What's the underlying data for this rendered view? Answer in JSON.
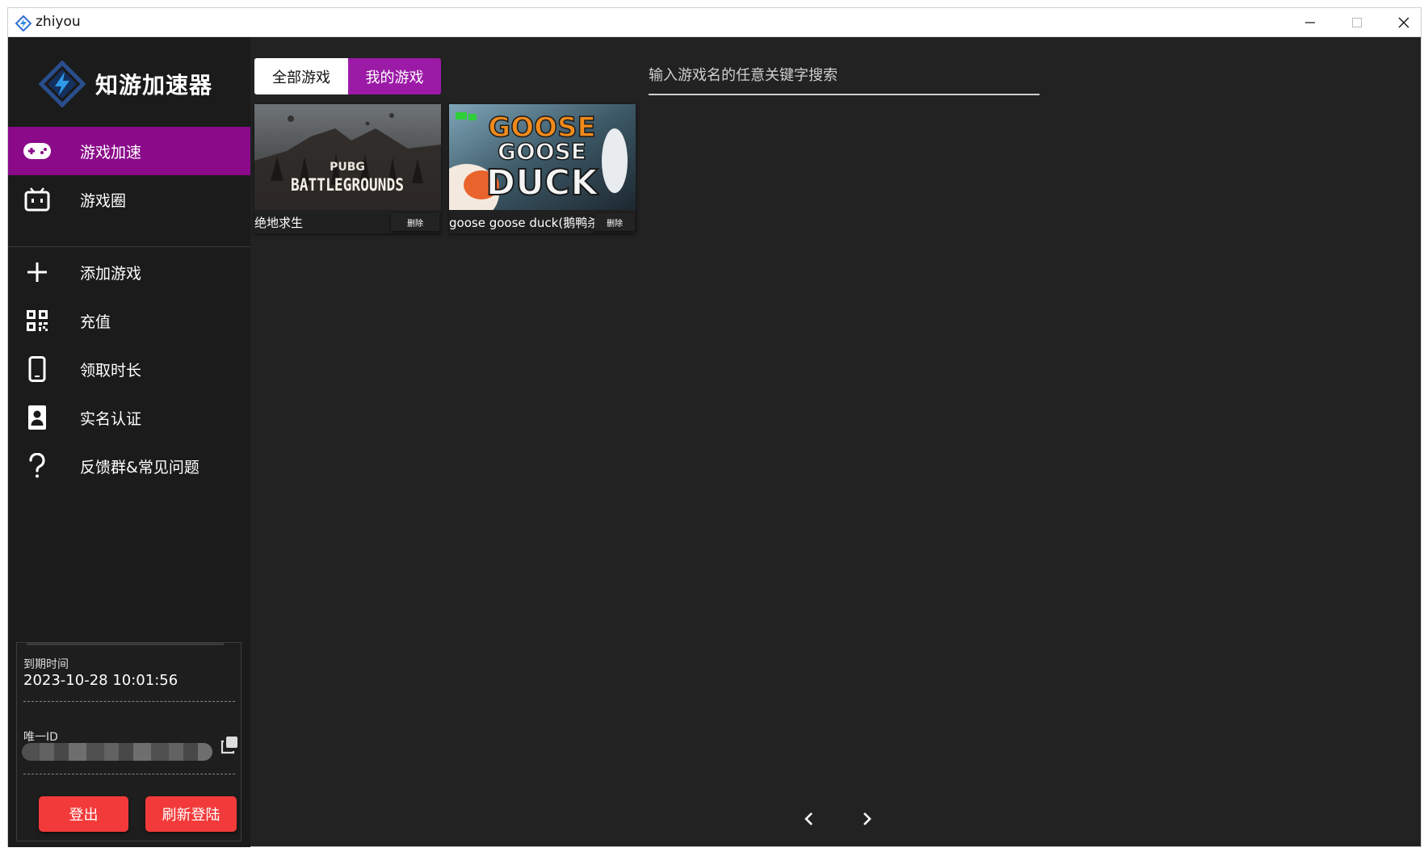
{
  "window": {
    "title": "zhiyou"
  },
  "app": {
    "name": "知游加速器",
    "accent": "#8a0a8a",
    "danger": "#f23a3a"
  },
  "nav": {
    "primary": [
      {
        "label": "游戏加速",
        "icon": "gamepad-icon",
        "active": true
      },
      {
        "label": "游戏圈",
        "icon": "tv-icon",
        "active": false
      }
    ],
    "secondary": [
      {
        "label": "添加游戏",
        "icon": "plus-icon"
      },
      {
        "label": "充值",
        "icon": "qrcode-icon"
      },
      {
        "label": "领取时长",
        "icon": "phone-icon"
      },
      {
        "label": "实名认证",
        "icon": "id-badge-icon"
      },
      {
        "label": "反馈群&常见问题",
        "icon": "question-icon"
      }
    ]
  },
  "account": {
    "expiry_label": "到期时间",
    "expiry_value": "2023-10-28 10:01:56",
    "id_label": "唯一ID",
    "logout_label": "登出",
    "refresh_label": "刷新登陆"
  },
  "tabs": [
    {
      "label": "全部游戏",
      "active": false
    },
    {
      "label": "我的游戏",
      "active": true
    }
  ],
  "search": {
    "placeholder": "输入游戏名的任意关键字搜索"
  },
  "games": [
    {
      "name": "绝地求生",
      "delete_label": "删除",
      "art_text": [
        "PUBG",
        "BATTLEGROUNDS"
      ]
    },
    {
      "name": "goose goose duck(鹅鸭杀)",
      "delete_label": "删除",
      "art_text": [
        "GOOSE",
        "GOOSE",
        "DUCK"
      ]
    }
  ]
}
